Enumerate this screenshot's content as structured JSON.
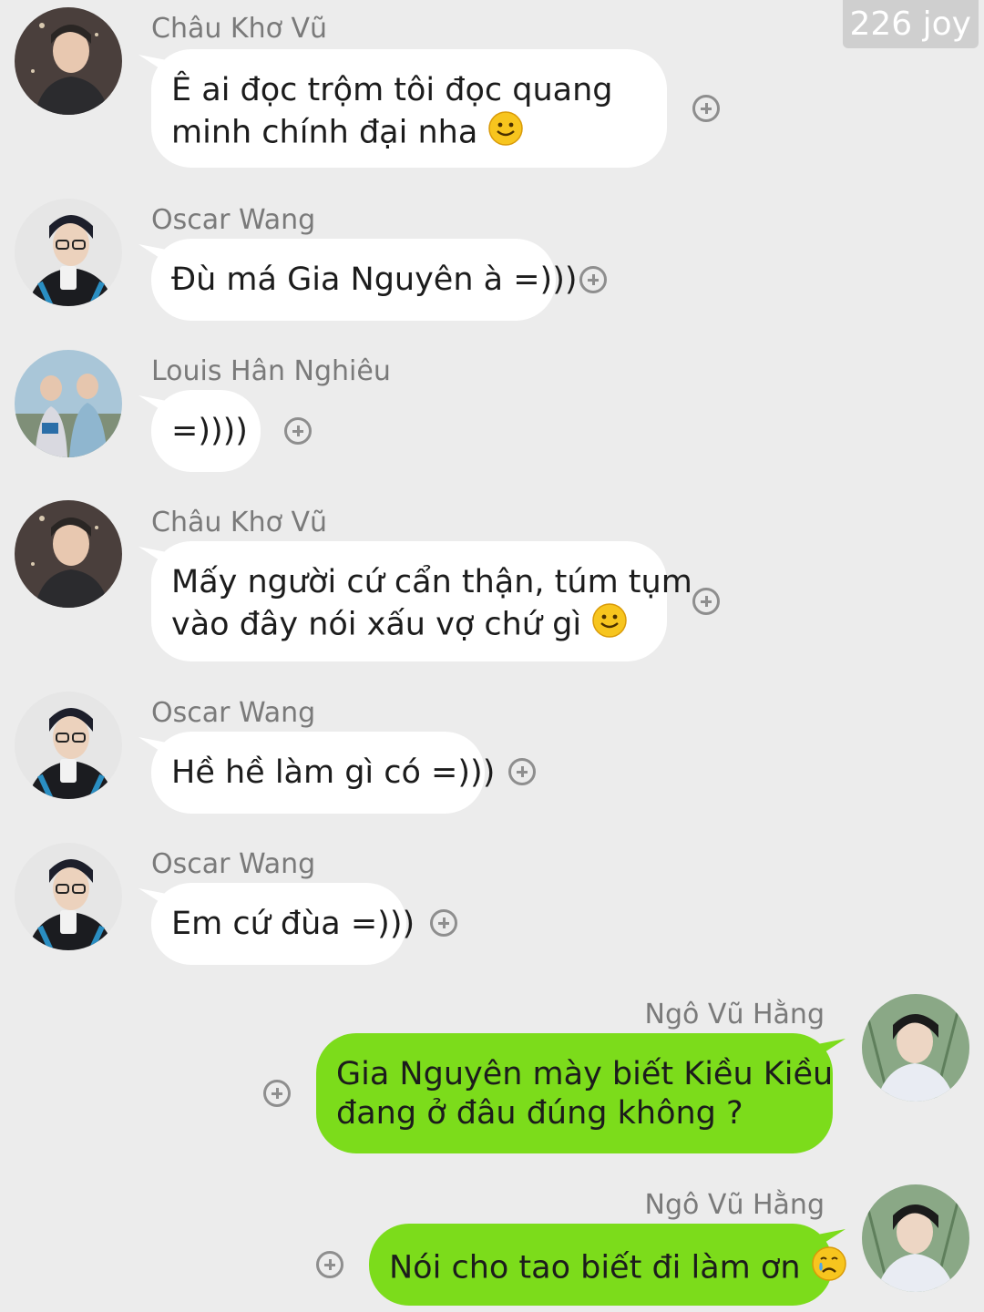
{
  "watermark": "226 joy",
  "colors": {
    "background": "#ececec",
    "incoming_bubble": "#ffffff",
    "outgoing_bubble": "#7cdc1b",
    "sender_text": "#7a7a7a"
  },
  "messages": [
    {
      "direction": "incoming",
      "sender": "Châu Khơ Vũ",
      "lines": [
        "Ê ai đọc trộm tôi đọc quang",
        "minh chính đại nha"
      ],
      "emoji": "slightly-smiling-face-icon"
    },
    {
      "direction": "incoming",
      "sender": "Oscar Wang",
      "lines": [
        "Đù má Gia Nguyên à =)))"
      ]
    },
    {
      "direction": "incoming",
      "sender": "Louis Hân Nghiêu",
      "lines": [
        "=))))"
      ]
    },
    {
      "direction": "incoming",
      "sender": "Châu Khơ Vũ",
      "lines": [
        "Mấy người cứ cẩn thận, túm tụm",
        "vào đây nói xấu vợ chứ gì"
      ],
      "emoji": "slightly-smiling-face-icon"
    },
    {
      "direction": "incoming",
      "sender": "Oscar Wang",
      "lines": [
        "Hề hề làm gì có =)))"
      ]
    },
    {
      "direction": "incoming",
      "sender": "Oscar Wang",
      "lines": [
        "Em cứ đùa =)))"
      ]
    },
    {
      "direction": "outgoing",
      "sender": "Ngô Vũ Hằng",
      "lines": [
        "Gia Nguyên mày biết Kiều Kiều",
        "đang ở đâu đúng không ?"
      ]
    },
    {
      "direction": "outgoing",
      "sender": "Ngô Vũ Hằng",
      "lines": [
        "Nói cho tao biết đi làm ơn"
      ],
      "emoji": "crying-face-icon"
    }
  ]
}
